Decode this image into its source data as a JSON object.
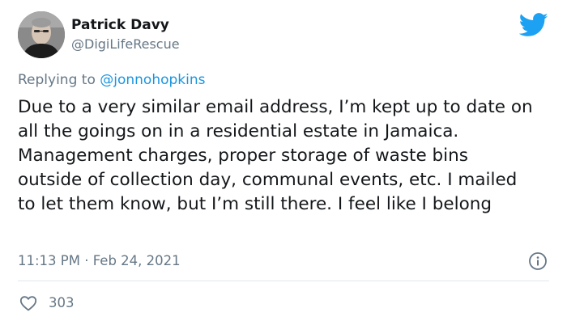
{
  "author": {
    "display_name": "Patrick Davy",
    "handle": "@DigiLifeRescue",
    "avatar_icon": "avatar-photo"
  },
  "reply": {
    "prefix": "Replying to ",
    "mention": "@jonnohopkins"
  },
  "tweet": {
    "text": "Due to a very similar email address, I’m kept up to date on all the goings on in a residential estate in Jamaica. Management charges, proper storage of waste bins outside of collection day, communal events, etc. I mailed to let them know, but I’m still there. I feel like I belong",
    "timestamp": "11:13 PM · Feb 24, 2021"
  },
  "engagement": {
    "likes": "303"
  },
  "icons": {
    "brand": "twitter-bird-icon",
    "info": "info-icon",
    "like": "heart-icon"
  },
  "colors": {
    "brand_blue": "#1da1f2",
    "mention_blue": "#1b95e0",
    "secondary_text": "#657786",
    "primary_text": "#14171a",
    "divider": "#e1e8ed"
  }
}
